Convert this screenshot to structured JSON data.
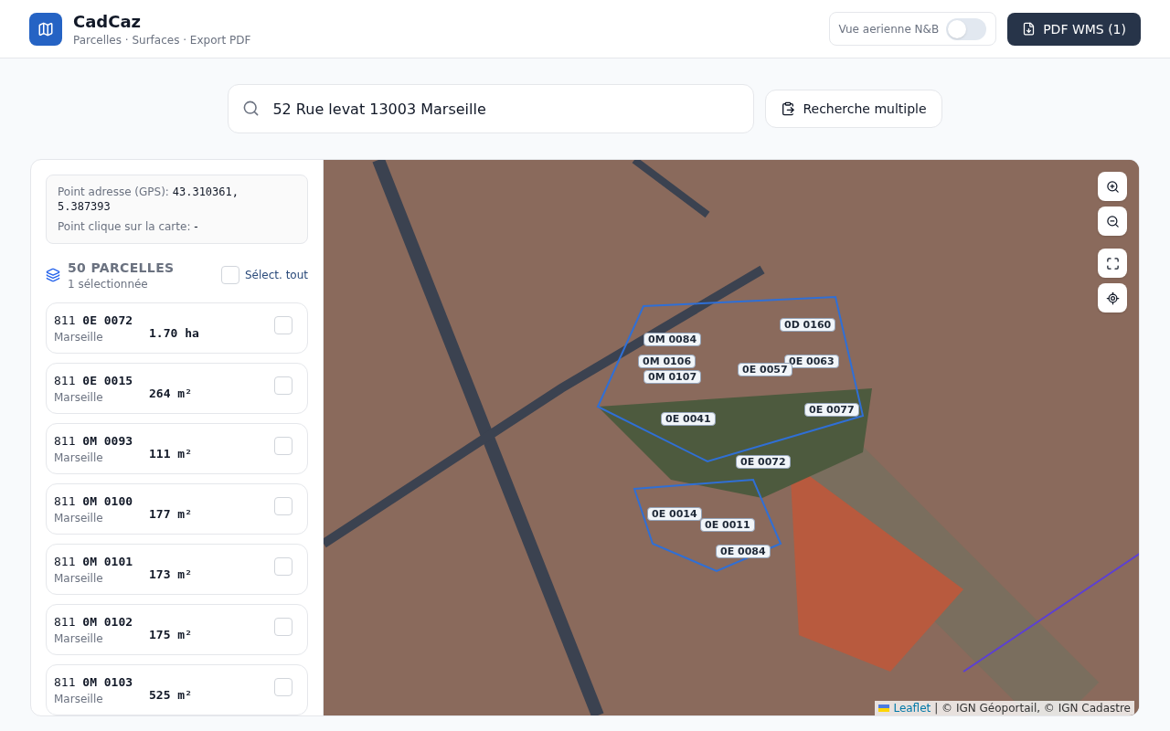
{
  "app": {
    "title": "CadCaz",
    "subtitle": "Parcelles · Surfaces · Export PDF"
  },
  "aerial_toggle": {
    "label": "Vue aerienne N&B",
    "on": false
  },
  "pdf_button": {
    "label": "PDF WMS (1)"
  },
  "search": {
    "value": "52 Rue levat 13003 Marseille"
  },
  "multi_search_button": {
    "label": "Recherche multiple"
  },
  "info": {
    "gps_label": "Point adresse (GPS):",
    "gps_value": "43.310361, 5.387393",
    "click_label": "Point clique sur la carte:",
    "click_value": "-"
  },
  "parcels_header": {
    "title": "50 PARCELLES",
    "subtitle": "1 sélectionnée",
    "select_all": {
      "label": "Sélect. tout",
      "checked": false
    }
  },
  "parcels": [
    {
      "prefix": "811",
      "code": "0E 0072",
      "city": "Marseille",
      "area": "1.70 ha",
      "checked": false
    },
    {
      "prefix": "811",
      "code": "0E 0015",
      "city": "Marseille",
      "area": "264 m²",
      "checked": false
    },
    {
      "prefix": "811",
      "code": "0M 0093",
      "city": "Marseille",
      "area": "111 m²",
      "checked": false
    },
    {
      "prefix": "811",
      "code": "0M 0100",
      "city": "Marseille",
      "area": "177 m²",
      "checked": false
    },
    {
      "prefix": "811",
      "code": "0M 0101",
      "city": "Marseille",
      "area": "173 m²",
      "checked": false
    },
    {
      "prefix": "811",
      "code": "0M 0102",
      "city": "Marseille",
      "area": "175 m²",
      "checked": false
    },
    {
      "prefix": "811",
      "code": "0M 0103",
      "city": "Marseille",
      "area": "525 m²",
      "checked": false
    }
  ],
  "map": {
    "labels": [
      "0D 0160",
      "0M 0084",
      "0M 0106",
      "0M 0107",
      "0E 0063",
      "0E 0057",
      "0E 0077",
      "0E 0041",
      "0E 0072",
      "0E 0014",
      "0E 0011",
      "0E 0084"
    ],
    "attribution": {
      "link": "Leaflet",
      "text": "| © IGN Géoportail, © IGN Cadastre"
    }
  }
}
